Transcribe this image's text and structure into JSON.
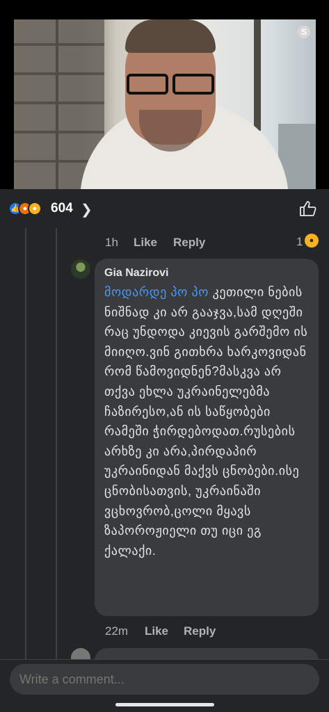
{
  "reactions": {
    "count": "604",
    "types": [
      "like-icon",
      "angry-icon",
      "haha-icon"
    ]
  },
  "first_comment_meta": {
    "time": "1h",
    "like_label": "Like",
    "reply_label": "Reply",
    "reaction_count": "1",
    "reaction_type": "haha-icon"
  },
  "reply": {
    "author": "Gia Nazirovi",
    "mention": "მოდარდე პო პო",
    "text": " კეთილი ნების ნიშნად კი არ გააჯვა,სამ დღეში რაც უნდოდა კიევის გარშემო ის მიიღო.ვინ გითხრა ხარკოვიდან რომ წამოვიდნენ?მასკვა არ თქვა ეხლა უკრაინელებმა ჩაზირესო,ან ის საწყობები რამეში ჭირდებოდათ.რუსების არხზე კი არა,პირდაპირ უკრაინიდან მაქვს ცნობები.ისე ცნობისათვის, უკრაინაში ვცხოვრობ,ცოლი მყავს ზაპოროჟიელი თუ იცი ეგ ქალაქი.",
    "time": "22m",
    "like_label": "Like",
    "reply_label": "Reply"
  },
  "composer": {
    "placeholder": "Write a comment..."
  },
  "colors": {
    "background": "#242526",
    "bubble": "#3a3b3c",
    "mention": "#4599ff",
    "like_blue": "#1877f2"
  }
}
